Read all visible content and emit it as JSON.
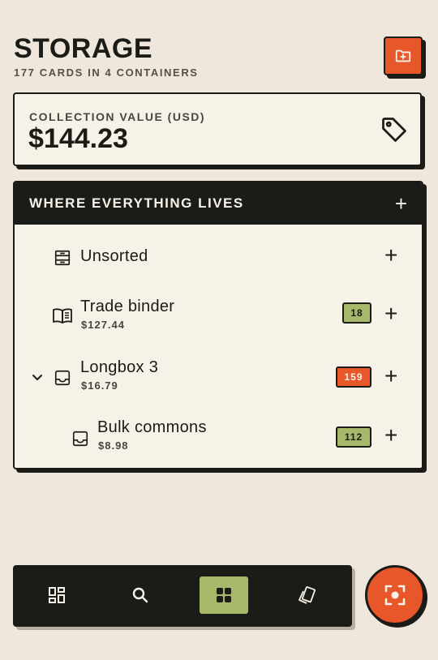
{
  "header": {
    "title": "STORAGE",
    "subtitle": "177 CARDS IN 4 CONTAINERS",
    "new_container_icon": "folder-plus-icon"
  },
  "value_card": {
    "label": "COLLECTION VALUE (USD)",
    "amount": "$144.23",
    "icon": "tag-icon"
  },
  "locations": {
    "title": "WHERE EVERYTHING LIVES",
    "add_label": "+",
    "rows": [
      {
        "name": "Unsorted",
        "price": "",
        "count": "",
        "icon": "tray-stack-icon"
      },
      {
        "name": "Trade binder",
        "price": "$127.44",
        "count": "18",
        "icon": "open-book-icon"
      },
      {
        "name": "Longbox 3",
        "price": "$16.79",
        "count": "159",
        "icon": "inbox-icon",
        "expanded": true
      },
      {
        "name": "Bulk commons",
        "price": "$8.98",
        "count": "112",
        "icon": "inbox-icon"
      }
    ]
  },
  "colors": {
    "background": "#efe7dc",
    "ink": "#1b1b17",
    "accent_orange": "#e8572a",
    "accent_green": "#a8b86a",
    "card": "#f6f2e8"
  },
  "nav": {
    "items": [
      {
        "icon": "dashboard-icon",
        "active": false
      },
      {
        "icon": "search-icon",
        "active": false
      },
      {
        "icon": "grid-icon",
        "active": true
      },
      {
        "icon": "cards-icon",
        "active": false
      }
    ],
    "fab_icon": "scan-icon"
  }
}
